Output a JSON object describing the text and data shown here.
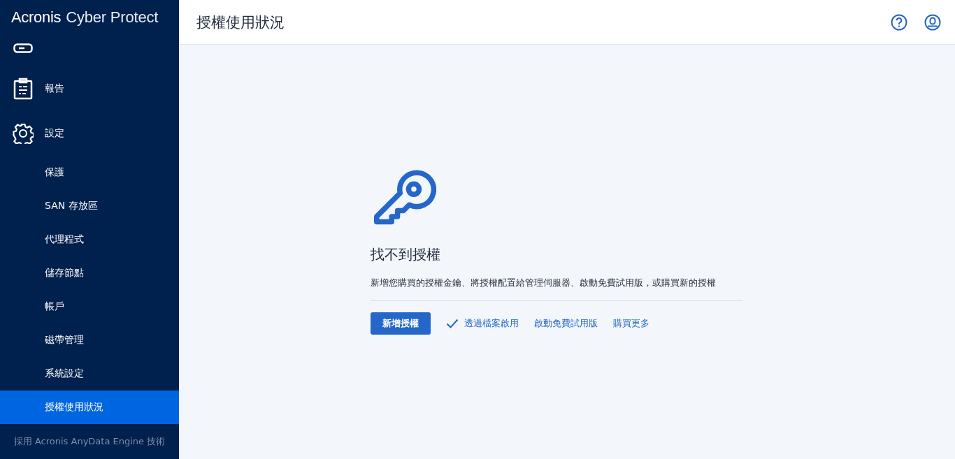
{
  "logo": {
    "brand": "Acronis",
    "product": "Cyber Protect"
  },
  "sidebar": {
    "items": [
      {
        "kind": "main",
        "selected": false
      },
      {
        "kind": "main",
        "label": "報告",
        "selected": false
      },
      {
        "kind": "main",
        "label": "設定",
        "selected": false
      },
      {
        "kind": "sub",
        "label": "保護",
        "selected": false
      },
      {
        "kind": "sub",
        "label": "SAN 存放區",
        "selected": false
      },
      {
        "kind": "sub",
        "label": "代理程式",
        "selected": false
      },
      {
        "kind": "sub",
        "label": "儲存節點",
        "selected": false
      },
      {
        "kind": "sub",
        "label": "帳戶",
        "selected": false
      },
      {
        "kind": "sub",
        "label": "磁帶管理",
        "selected": false
      },
      {
        "kind": "sub",
        "label": "系統設定",
        "selected": false
      },
      {
        "kind": "sub",
        "label": "授權使用狀況",
        "selected": true
      }
    ],
    "footer": "採用 Acronis AnyData Engine 技術"
  },
  "header": {
    "title": "授權使用狀況"
  },
  "empty_state": {
    "title": "找不到授權",
    "description": "新增您購買的授權金鑰、將授權配置給管理伺服器、啟動免費試用版，或購買新的授權",
    "actions": [
      {
        "kind": "primary",
        "label": "新增授權"
      },
      {
        "kind": "check-link",
        "label": "透過檔案啟用"
      },
      {
        "kind": "link",
        "label": "啟動免費試用版"
      },
      {
        "kind": "link",
        "label": "購買更多"
      }
    ]
  }
}
